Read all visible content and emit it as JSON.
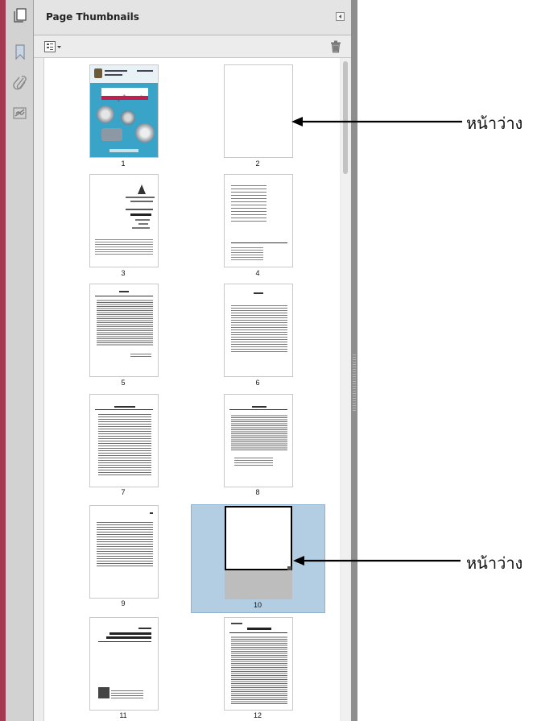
{
  "panel": {
    "title": "Page Thumbnails"
  },
  "nav_rail": {
    "icons": [
      "bookmark-icon",
      "attachment-icon",
      "signature-icon"
    ]
  },
  "toolbar": {
    "options_icon": "thumbnail-options-icon",
    "delete_icon": "trash-icon"
  },
  "thumbnails": [
    {
      "page": "1"
    },
    {
      "page": "2"
    },
    {
      "page": "3"
    },
    {
      "page": "4"
    },
    {
      "page": "5"
    },
    {
      "page": "6"
    },
    {
      "page": "7"
    },
    {
      "page": "8"
    },
    {
      "page": "9"
    },
    {
      "page": "10",
      "selected": true
    },
    {
      "page": "11"
    },
    {
      "page": "12"
    }
  ],
  "cover": {
    "banner_text": "ระบบสูบไฮดรอลิก"
  },
  "annotations": [
    {
      "label": "หน้าว่าง"
    },
    {
      "label": "หน้าว่าง"
    }
  ],
  "colors": {
    "selection": "#b3cde3",
    "cover": "#3aa3c8"
  }
}
